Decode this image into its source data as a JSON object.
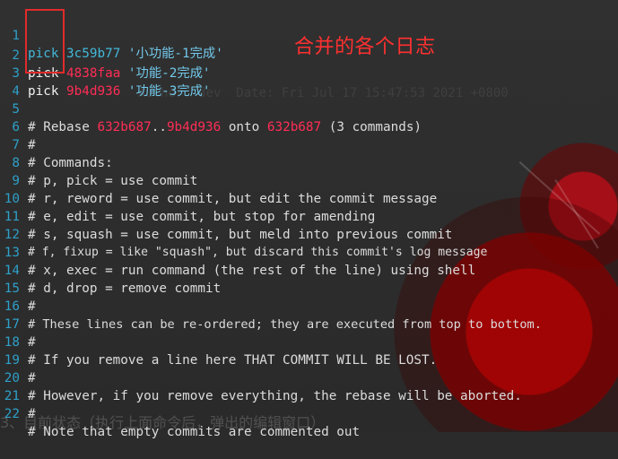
{
  "annotation": "合并的各个日志",
  "lines": [
    {
      "num": "1",
      "cmd": "pick",
      "hash": "3c59b77",
      "msg": "'小功能-1完成'"
    },
    {
      "num": "2",
      "cmd": "pick",
      "hash": "4838faa",
      "msg": "'功能-2完成'"
    },
    {
      "num": "3",
      "cmd": "pick",
      "hash": "9b4d936",
      "msg": "'功能-3完成'"
    },
    {
      "num": "4",
      "text": ""
    },
    {
      "num": "5",
      "prefix": "# Rebase ",
      "hash1": "632b687",
      "dots": "..",
      "hash2": "9b4d936",
      "mid": " onto ",
      "hash3": "632b687",
      "suffix": " (3 commands)"
    },
    {
      "num": "6",
      "text": "#"
    },
    {
      "num": "7",
      "text": "# Commands:"
    },
    {
      "num": "8",
      "text": "# p, pick = use commit"
    },
    {
      "num": "9",
      "text": "# r, reword = use commit, but edit the commit message"
    },
    {
      "num": "10",
      "text": "# e, edit = use commit, but stop for amending"
    },
    {
      "num": "11",
      "text": "# s, squash = use commit, but meld into previous commit"
    },
    {
      "num": "12",
      "text": "# f, fixup = like \"squash\", but discard this commit's log message"
    },
    {
      "num": "13",
      "text": "# x, exec = run command (the rest of the line) using shell"
    },
    {
      "num": "14",
      "text": "# d, drop = remove commit"
    },
    {
      "num": "15",
      "text": "#"
    },
    {
      "num": "16",
      "text": "# These lines can be re-ordered; they are executed from top to bottom."
    },
    {
      "num": "17",
      "text": "#"
    },
    {
      "num": "18",
      "text": "# If you remove a line here THAT COMMIT WILL BE LOST."
    },
    {
      "num": "19",
      "text": "#"
    },
    {
      "num": "20",
      "text": "# However, if you remove everything, the rebase will be aborted."
    },
    {
      "num": "21",
      "text": "#"
    },
    {
      "num": "22",
      "text": "# Note that empty commits are commented out"
    }
  ],
  "bottom_ghost": "3、目前状态（执行上面命令后，弹出的编辑窗口）"
}
